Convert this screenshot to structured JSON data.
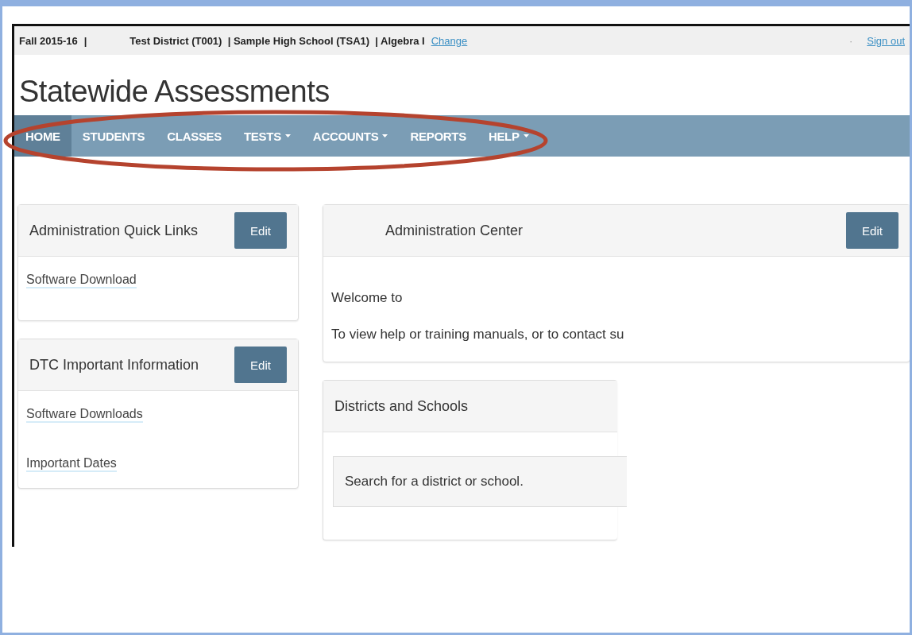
{
  "top_bar": {
    "term": "Fall 2015-16",
    "separator": "|",
    "context": "Test District (T001)  | Sample High School (TSA1)  | Algebra I",
    "change_link": "Change",
    "mark": "·",
    "sign_out": "Sign out"
  },
  "title": "Statewide Assessments",
  "nav": [
    {
      "label": "HOME",
      "selected": true,
      "dropdown": false
    },
    {
      "label": "STUDENTS",
      "selected": false,
      "dropdown": false
    },
    {
      "label": "CLASSES",
      "selected": false,
      "dropdown": false
    },
    {
      "label": "TESTS",
      "selected": false,
      "dropdown": true
    },
    {
      "label": "ACCOUNTS",
      "selected": false,
      "dropdown": true
    },
    {
      "label": "REPORTS",
      "selected": false,
      "dropdown": false
    },
    {
      "label": "HELP",
      "selected": false,
      "dropdown": true
    }
  ],
  "left_panels": [
    {
      "title": "Administration Quick Links",
      "button": "Edit",
      "links": [
        "Software Download"
      ]
    },
    {
      "title": "DTC Important Information",
      "button": "Edit",
      "links": [
        "Software Downloads",
        "Important Dates"
      ]
    }
  ],
  "admin_center": {
    "title": "Administration Center",
    "button": "Edit",
    "lines": [
      "Welcome to",
      "To view help or training manuals, or to contact su"
    ]
  },
  "districts": {
    "title": "Districts and Schools",
    "search_placeholder": "Search for a district or school."
  }
}
